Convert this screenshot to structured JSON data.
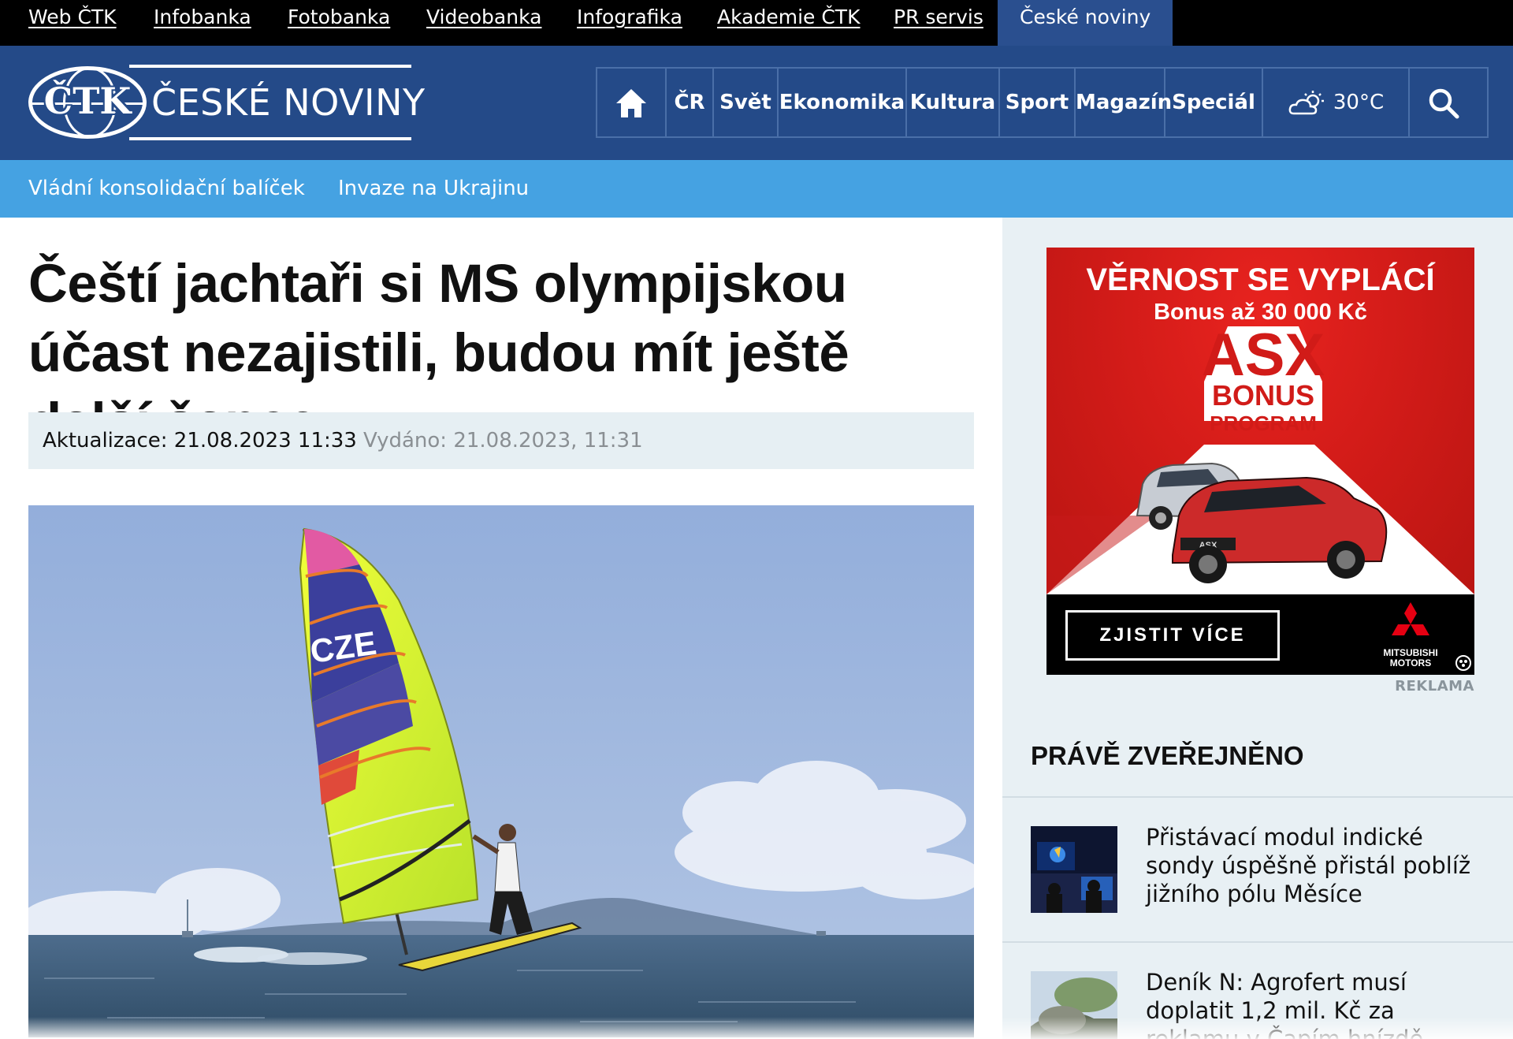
{
  "topbar": {
    "links": [
      "Web ČTK",
      "Infobanka",
      "Fotobanka",
      "Videobanka",
      "Infografika",
      "Akademie ČTK",
      "PR servis"
    ],
    "active": "České noviny"
  },
  "header": {
    "logo_mark": "ČTK",
    "logo_text": "ČESKÉ NOVINY",
    "nav": [
      "ČR",
      "Svět",
      "Ekonomika",
      "Kultura",
      "Sport",
      "Magazín",
      "Speciál"
    ],
    "weather": "30°C",
    "icons": [
      "home-icon",
      "weather-partly-sunny-icon",
      "search-icon"
    ]
  },
  "subnav": [
    "Vládní konsolidační balíček",
    "Invaze na Ukrajinu"
  ],
  "article": {
    "title": "Čeští jachtaři si MS olympijskou účast nezajistili, budou mít ještě další šance",
    "updated": "Aktualizace: 21.08.2023 11:33",
    "published": "Vydáno: 21.08.2023, 11:31",
    "photo_text": "CZE"
  },
  "ad": {
    "headline": "VĚRNOST SE VYPLÁCÍ",
    "subheadline": "Bonus až 30 000 Kč",
    "program_big": "ASX",
    "program_bonus": "BONUS",
    "program_word": "PROGRAM",
    "car_badge": "ASX",
    "cta": "ZJISTIT VÍCE",
    "brand_line1": "MITSUBISHI",
    "brand_line2": "MOTORS",
    "label": "REKLAMA"
  },
  "latest": {
    "title": "PRÁVĚ ZVEŘEJNĚNO",
    "items": [
      {
        "text": "Přistávací modul indické sondy úspěšně přistál poblíž jižního pólu Měsíce"
      },
      {
        "text": "Deník N: Agrofert musí doplatit 1,2 mil. Kč za reklamu v Čapím hnízdě"
      }
    ]
  },
  "colors": {
    "topbar": "#000000",
    "header": "#244a88",
    "subbar": "#45a2e2",
    "sidebar": "#e8f0f4",
    "ad_red": "#d11b18"
  }
}
